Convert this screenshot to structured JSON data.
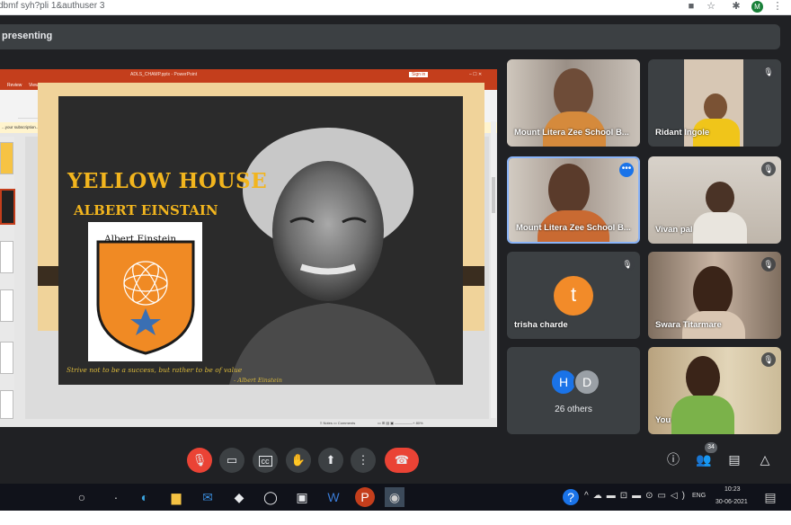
{
  "browser": {
    "url_fragment": "dbmf syh?pli  1&authuser  3",
    "profile_initial": "M",
    "icons": [
      "camera-icon",
      "star-icon",
      "extensions-icon",
      "menu-icon"
    ]
  },
  "presenting": {
    "label": "presenting"
  },
  "slide": {
    "title": "YELLOW HOUSE",
    "subtitle": "ALBERT EINSTAIN",
    "crest_name": "Albert Einstein",
    "quote": "Strive not to be a success, but rather to be of value",
    "attribution": "- Albert Einstein",
    "colors": {
      "bg": "#2b2b2b",
      "title": "#f2b51e",
      "crest": "#f08a24"
    }
  },
  "participants": [
    {
      "name": "Mount Litera Zee School B...",
      "muted": false,
      "color": "#8a7f77"
    },
    {
      "name": "Ridant Ingole",
      "muted": true,
      "color": "#d7c7b4"
    },
    {
      "name": "Mount Litera Zee School B...",
      "muted": false,
      "active": true,
      "color": "#9c8f86"
    },
    {
      "name": "Vivan pal",
      "muted": true,
      "color": "#cdc6bd"
    },
    {
      "name": "trisha charde",
      "muted": true,
      "initial": "t",
      "color": "#3c4043",
      "avatar": "#f28b29"
    },
    {
      "name": "Swara Titarmare",
      "muted": true,
      "color": "#b89c87"
    },
    {
      "name": "26 others",
      "muted": false,
      "avatars": [
        "H",
        "D"
      ],
      "color": "#3c4043"
    },
    {
      "name": "You",
      "muted": true,
      "color": "#d8c9a8"
    }
  ],
  "controls": {
    "participant_count": "34",
    "buttons": [
      "mic-off-icon",
      "camera-icon",
      "captions-icon",
      "raise-hand-icon",
      "present-icon",
      "more-icon",
      "end-call-icon"
    ],
    "right": [
      "info-icon",
      "people-icon",
      "chat-icon",
      "activities-icon"
    ]
  },
  "taskbar": {
    "lang": "ENG",
    "time": "10:23",
    "date": "30-06-2021"
  }
}
